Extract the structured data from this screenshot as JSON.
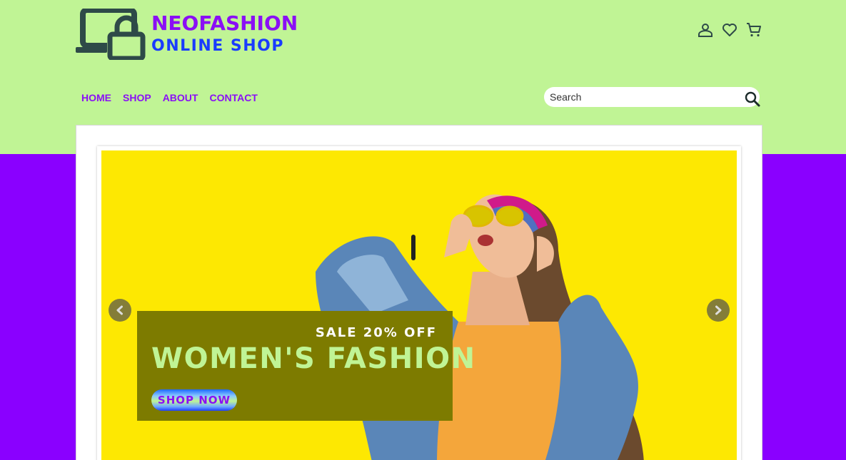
{
  "brand": {
    "name": "NEOFASHION",
    "tagline": "ONLINE SHOP",
    "name_color": "#8a0ff5",
    "tagline_color": "#1a3cff"
  },
  "header": {
    "icons": [
      "user-icon",
      "heart-icon",
      "cart-icon"
    ]
  },
  "nav": {
    "items": [
      {
        "label": "HOME"
      },
      {
        "label": "SHOP"
      },
      {
        "label": "ABOUT"
      },
      {
        "label": "CONTACT"
      }
    ]
  },
  "search": {
    "placeholder": "Search",
    "value": ""
  },
  "hero": {
    "sale_text": "SALE 20% OFF",
    "headline": "WOMEN'S FASHION",
    "cta_label": "SHOP NOW",
    "background_color": "#fde802",
    "prev_icon": "chevron-left-icon",
    "next_icon": "chevron-right-icon"
  },
  "colors": {
    "header_bg": "#c0f495",
    "page_bg": "#8a00ff",
    "accent": "#8a0ff5"
  }
}
